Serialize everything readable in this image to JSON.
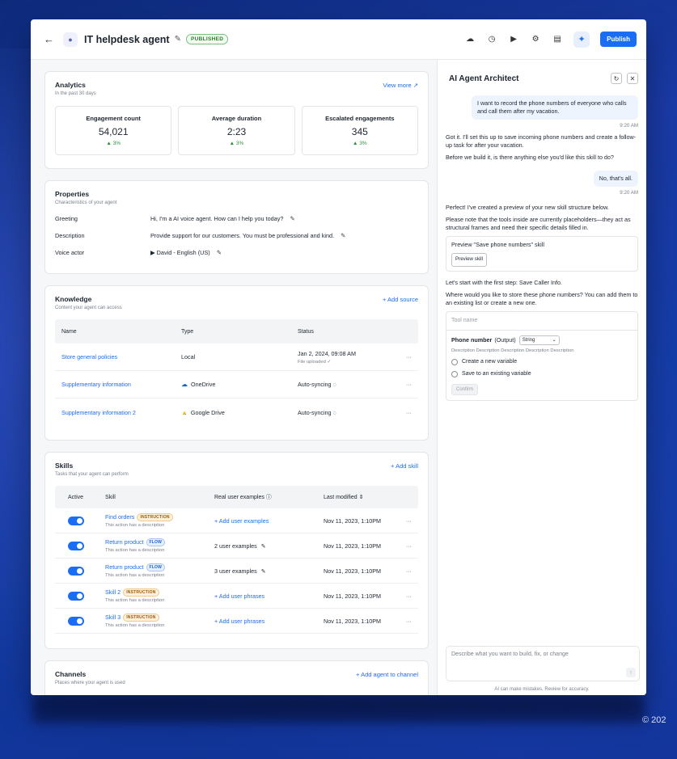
{
  "header": {
    "agent_name": "IT helpdesk agent",
    "status_badge": "PUBLISHED",
    "publish_label": "Publish"
  },
  "analytics": {
    "title": "Analytics",
    "subtitle": "In the past 30 days",
    "view_more": "View more ↗",
    "stats": [
      {
        "label": "Engagement count",
        "value": "54,021",
        "delta": "▲ 3%"
      },
      {
        "label": "Average duration",
        "value": "2:23",
        "delta": "▲ 3%"
      },
      {
        "label": "Escalated engagements",
        "value": "345",
        "delta": "▲ 3%"
      }
    ]
  },
  "properties": {
    "title": "Properties",
    "subtitle": "Characteristics of your agent",
    "rows": [
      {
        "label": "Greeting",
        "value": "Hi, I'm a AI voice agent. How can I help you today?"
      },
      {
        "label": "Description",
        "value": "Provide support for our customers. You must be professional and kind."
      },
      {
        "label": "Voice actor",
        "value": "▶  David - English (US)"
      }
    ]
  },
  "knowledge": {
    "title": "Knowledge",
    "subtitle": "Content your agent can access",
    "add_label": "+ Add source",
    "columns": [
      "Name",
      "Type",
      "Status"
    ],
    "rows": [
      {
        "name": "Store general policies",
        "type": "Local",
        "status": "Jan 2, 2024, 09:08 AM",
        "note": "File uploaded ✓"
      },
      {
        "name": "Supplementary information",
        "type": "OneDrive",
        "status": "Auto-syncing ◌",
        "note": ""
      },
      {
        "name": "Supplementary information 2",
        "type": "Google Drive",
        "status": "Auto-syncing ◌",
        "note": ""
      }
    ]
  },
  "skills": {
    "title": "Skills",
    "subtitle": "Tasks that your agent can perform",
    "add_label": "+ Add skill",
    "columns": [
      "Active",
      "Skill",
      "Real user examples  ⓘ",
      "Last modified  ⇕"
    ],
    "rows": [
      {
        "name": "Find orders",
        "tag": "INSTRUCTION",
        "desc": "This action has a description",
        "examples": "+ Add user examples",
        "modified": "Nov 11, 2023, 1:10PM"
      },
      {
        "name": "Return product",
        "tag": "FLOW",
        "desc": "This action has a description",
        "examples": "2 user examples",
        "modified": "Nov 11, 2023, 1:10PM"
      },
      {
        "name": "Return product",
        "tag": "FLOW",
        "desc": "This action has a description",
        "examples": "3 user examples",
        "modified": "Nov 11, 2023, 1:10PM"
      },
      {
        "name": "Skill 2",
        "tag": "INSTRUCTION",
        "desc": "This action has a description",
        "examples": "+ Add user phrases",
        "modified": "Nov 11, 2023, 1:10PM"
      },
      {
        "name": "Skill 3",
        "tag": "INSTRUCTION",
        "desc": "This action has a description",
        "examples": "+ Add user phrases",
        "modified": "Nov 11, 2023, 1:10PM"
      }
    ]
  },
  "channels": {
    "title": "Channels",
    "subtitle": "Places where your agent is used",
    "add_label": "+ Add agent to channel"
  },
  "architect": {
    "title": "AI Agent Architect",
    "msg1_user": "I want to record the phone numbers of everyone who calls and call them after my vacation.",
    "time1": "9:20 AM",
    "msg2_a": "Got it. I'll set this up to save incoming phone numbers and create a follow-up task for after your vacation.",
    "msg2_b": "Before we build it, is there anything else you'd like this skill to do?",
    "msg3_user": "No, that's all.",
    "time2": "9:20 AM",
    "msg4_a": "Perfect! I've created a preview of your new skill structure below.",
    "msg4_b": "Please note that the tools inside are currently placeholders—they act as structural frames and need their specific details filled in.",
    "preview_title": "Preview \"Save phone numbers\" skill",
    "preview_btn": "Preview skill",
    "msg5_a": "Let's start with the first step: Save Caller Info.",
    "msg5_b": "Where would you like to store these phone numbers? You can add them to an existing list or create a new one.",
    "tool_name_placeholder": "Tool name",
    "phone_label": "Phone number",
    "phone_output": "(Output)",
    "type_select": "String",
    "tool_desc": "Description Description Description Description Description",
    "radio1": "Create a new variable",
    "radio2": "Save to an existing variable",
    "confirm": "Confirm",
    "composer_placeholder": "Describe what you want to build, fix, or change",
    "disclaimer": "AI can make mistakes. Review for accuracy."
  },
  "footer": {
    "copyright": "© 202"
  }
}
